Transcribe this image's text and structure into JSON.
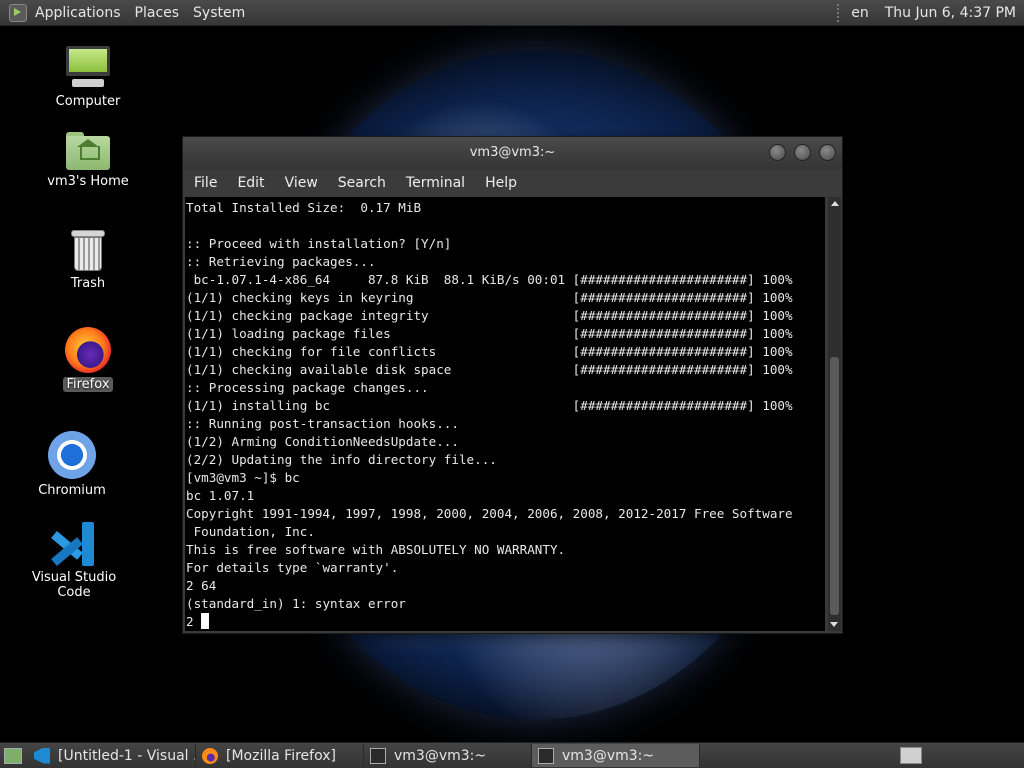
{
  "top_panel": {
    "menus": [
      "Applications",
      "Places",
      "System"
    ],
    "keyboard_layout": "en",
    "clock": "Thu Jun  6,  4:37 PM"
  },
  "desktop_icons": [
    {
      "label": "Computer",
      "icon": "computer-icon"
    },
    {
      "label": "vm3's Home",
      "icon": "home-folder-icon"
    },
    {
      "label": "Trash",
      "icon": "trash-icon"
    },
    {
      "label": "Firefox",
      "icon": "firefox-icon"
    },
    {
      "label": "Chromium",
      "icon": "chromium-icon"
    },
    {
      "label": "Visual Studio Code",
      "icon": "vscode-icon"
    }
  ],
  "terminal": {
    "title": "vm3@vm3:~",
    "menu": [
      "File",
      "Edit",
      "View",
      "Search",
      "Terminal",
      "Help"
    ],
    "output": "Total Installed Size:  0.17 MiB\n\n:: Proceed with installation? [Y/n]\n:: Retrieving packages...\n bc-1.07.1-4-x86_64     87.8 KiB  88.1 KiB/s 00:01 [######################] 100%\n(1/1) checking keys in keyring                     [######################] 100%\n(1/1) checking package integrity                   [######################] 100%\n(1/1) loading package files                        [######################] 100%\n(1/1) checking for file conflicts                  [######################] 100%\n(1/1) checking available disk space                [######################] 100%\n:: Processing package changes...\n(1/1) installing bc                                [######################] 100%\n:: Running post-transaction hooks...\n(1/2) Arming ConditionNeedsUpdate...\n(2/2) Updating the info directory file...\n[vm3@vm3 ~]$ bc\nbc 1.07.1\nCopyright 1991-1994, 1997, 1998, 2000, 2004, 2006, 2008, 2012-2017 Free Software\n Foundation, Inc.\nThis is free software with ABSOLUTELY NO WARRANTY.\nFor details type `warranty'.\n2 64\n(standard_in) 1: syntax error\n",
    "current_input": "2 "
  },
  "taskbar": {
    "tasks": [
      {
        "label": "[Untitled-1 - Visual ...",
        "icon": "vscode-icon",
        "active": false
      },
      {
        "label": "[Mozilla Firefox]",
        "icon": "firefox-icon",
        "active": false
      },
      {
        "label": "vm3@vm3:~",
        "icon": "terminal-icon",
        "active": false
      },
      {
        "label": "vm3@vm3:~",
        "icon": "terminal-icon",
        "active": true
      }
    ]
  }
}
